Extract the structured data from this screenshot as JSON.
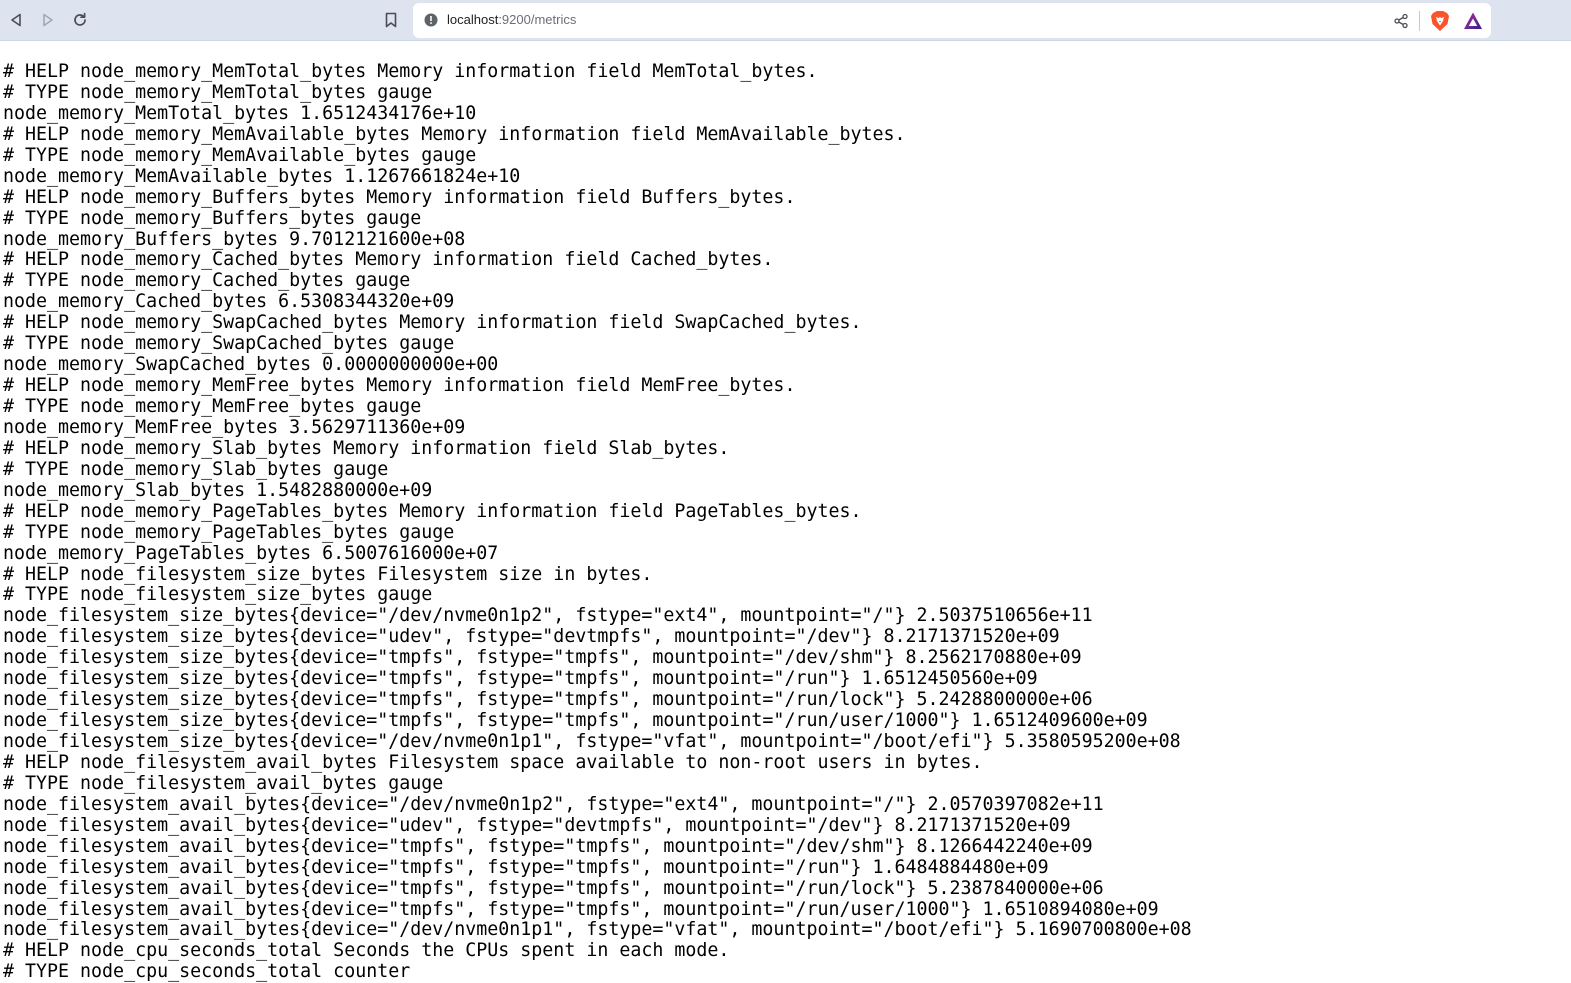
{
  "browser": {
    "url_host": "localhost",
    "url_path": ":9200/metrics"
  },
  "metrics_lines": [
    "# HELP node_memory_MemTotal_bytes Memory information field MemTotal_bytes.",
    "# TYPE node_memory_MemTotal_bytes gauge",
    "node_memory_MemTotal_bytes 1.6512434176e+10",
    "# HELP node_memory_MemAvailable_bytes Memory information field MemAvailable_bytes.",
    "# TYPE node_memory_MemAvailable_bytes gauge",
    "node_memory_MemAvailable_bytes 1.1267661824e+10",
    "# HELP node_memory_Buffers_bytes Memory information field Buffers_bytes.",
    "# TYPE node_memory_Buffers_bytes gauge",
    "node_memory_Buffers_bytes 9.7012121600e+08",
    "# HELP node_memory_Cached_bytes Memory information field Cached_bytes.",
    "# TYPE node_memory_Cached_bytes gauge",
    "node_memory_Cached_bytes 6.5308344320e+09",
    "# HELP node_memory_SwapCached_bytes Memory information field SwapCached_bytes.",
    "# TYPE node_memory_SwapCached_bytes gauge",
    "node_memory_SwapCached_bytes 0.0000000000e+00",
    "# HELP node_memory_MemFree_bytes Memory information field MemFree_bytes.",
    "# TYPE node_memory_MemFree_bytes gauge",
    "node_memory_MemFree_bytes 3.5629711360e+09",
    "# HELP node_memory_Slab_bytes Memory information field Slab_bytes.",
    "# TYPE node_memory_Slab_bytes gauge",
    "node_memory_Slab_bytes 1.5482880000e+09",
    "# HELP node_memory_PageTables_bytes Memory information field PageTables_bytes.",
    "# TYPE node_memory_PageTables_bytes gauge",
    "node_memory_PageTables_bytes 6.5007616000e+07",
    "# HELP node_filesystem_size_bytes Filesystem size in bytes.",
    "# TYPE node_filesystem_size_bytes gauge",
    "node_filesystem_size_bytes{device=\"/dev/nvme0n1p2\", fstype=\"ext4\", mountpoint=\"/\"} 2.5037510656e+11",
    "node_filesystem_size_bytes{device=\"udev\", fstype=\"devtmpfs\", mountpoint=\"/dev\"} 8.2171371520e+09",
    "node_filesystem_size_bytes{device=\"tmpfs\", fstype=\"tmpfs\", mountpoint=\"/dev/shm\"} 8.2562170880e+09",
    "node_filesystem_size_bytes{device=\"tmpfs\", fstype=\"tmpfs\", mountpoint=\"/run\"} 1.6512450560e+09",
    "node_filesystem_size_bytes{device=\"tmpfs\", fstype=\"tmpfs\", mountpoint=\"/run/lock\"} 5.2428800000e+06",
    "node_filesystem_size_bytes{device=\"tmpfs\", fstype=\"tmpfs\", mountpoint=\"/run/user/1000\"} 1.6512409600e+09",
    "node_filesystem_size_bytes{device=\"/dev/nvme0n1p1\", fstype=\"vfat\", mountpoint=\"/boot/efi\"} 5.3580595200e+08",
    "# HELP node_filesystem_avail_bytes Filesystem space available to non-root users in bytes.",
    "# TYPE node_filesystem_avail_bytes gauge",
    "node_filesystem_avail_bytes{device=\"/dev/nvme0n1p2\", fstype=\"ext4\", mountpoint=\"/\"} 2.0570397082e+11",
    "node_filesystem_avail_bytes{device=\"udev\", fstype=\"devtmpfs\", mountpoint=\"/dev\"} 8.2171371520e+09",
    "node_filesystem_avail_bytes{device=\"tmpfs\", fstype=\"tmpfs\", mountpoint=\"/dev/shm\"} 8.1266442240e+09",
    "node_filesystem_avail_bytes{device=\"tmpfs\", fstype=\"tmpfs\", mountpoint=\"/run\"} 1.6484884480e+09",
    "node_filesystem_avail_bytes{device=\"tmpfs\", fstype=\"tmpfs\", mountpoint=\"/run/lock\"} 5.2387840000e+06",
    "node_filesystem_avail_bytes{device=\"tmpfs\", fstype=\"tmpfs\", mountpoint=\"/run/user/1000\"} 1.6510894080e+09",
    "node_filesystem_avail_bytes{device=\"/dev/nvme0n1p1\", fstype=\"vfat\", mountpoint=\"/boot/efi\"} 5.1690700800e+08",
    "# HELP node_cpu_seconds_total Seconds the CPUs spent in each mode.",
    "# TYPE node_cpu_seconds_total counter"
  ],
  "icons": {
    "back": "back-arrow-icon",
    "forward": "forward-arrow-icon",
    "reload": "reload-icon",
    "bookmark": "bookmark-icon",
    "site_info": "info-icon",
    "share": "share-icon",
    "brave_shields": "brave-lion-icon",
    "rewards": "triangle-rewards-icon"
  },
  "colors": {
    "toolbar_bg": "#dde3ef",
    "brave_orange": "#fb542b",
    "rewards_purple": "#662d91"
  }
}
